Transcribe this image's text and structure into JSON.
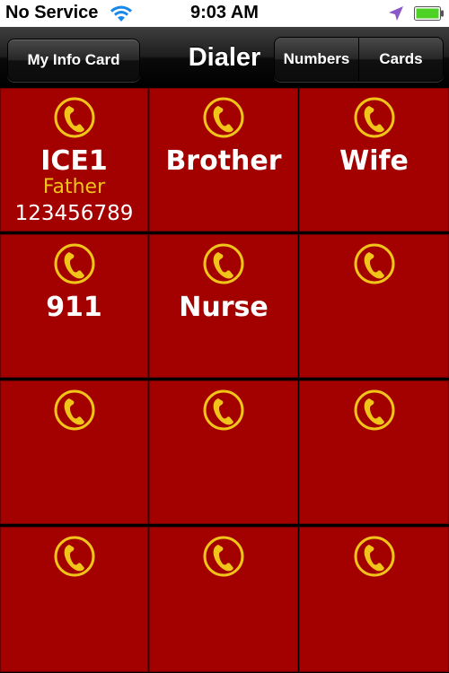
{
  "status_bar": {
    "carrier": "No Service",
    "time": "9:03 AM",
    "icons": [
      "wifi-icon",
      "location-icon",
      "battery-icon"
    ]
  },
  "nav": {
    "left_button": "My Info Card",
    "title": "Dialer",
    "segments": [
      "Numbers",
      "Cards"
    ]
  },
  "colors": {
    "tile": "#a30000",
    "phone_icon": "#f0c419",
    "relation_text": "#f0c419"
  },
  "tiles": [
    {
      "name": "ICE1",
      "relation": "Father",
      "number": "123456789"
    },
    {
      "name": "Brother",
      "relation": "",
      "number": ""
    },
    {
      "name": "Wife",
      "relation": "",
      "number": ""
    },
    {
      "name": "911",
      "relation": "",
      "number": ""
    },
    {
      "name": "Nurse",
      "relation": "",
      "number": ""
    },
    {
      "name": "",
      "relation": "",
      "number": ""
    },
    {
      "name": "",
      "relation": "",
      "number": ""
    },
    {
      "name": "",
      "relation": "",
      "number": ""
    },
    {
      "name": "",
      "relation": "",
      "number": ""
    },
    {
      "name": "",
      "relation": "",
      "number": ""
    },
    {
      "name": "",
      "relation": "",
      "number": ""
    },
    {
      "name": "",
      "relation": "",
      "number": ""
    }
  ]
}
